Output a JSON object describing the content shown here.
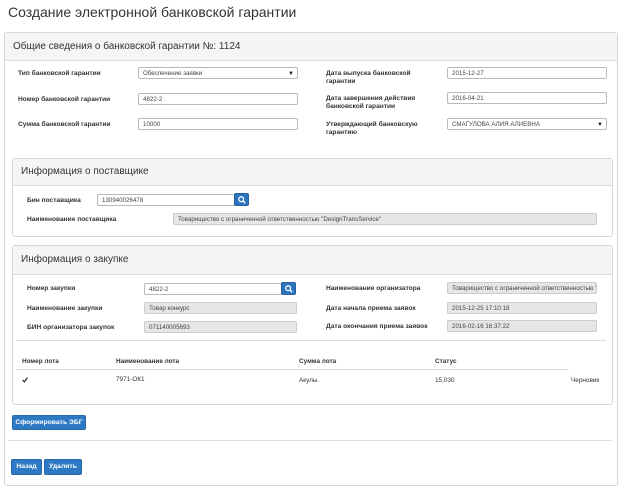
{
  "page": {
    "title": "Создание электронной банковской гарантии"
  },
  "general": {
    "header": "Общие сведения о банковской гарантии №: 1124",
    "guarantee_type": {
      "label": "Тип банковской гарантии",
      "value": "Обеспечение заявки"
    },
    "guarantee_number": {
      "label": "Номер банковской гарантии",
      "value": "4822-2"
    },
    "guarantee_amount": {
      "label": "Сумма банковской гарантии",
      "value": "10000"
    },
    "issue_date": {
      "label": "Дата выпуска банковской гарантии",
      "value": "2015-12-27"
    },
    "end_date": {
      "label": "Дата завершения действия банковской гарантии",
      "value": "2016-04-21"
    },
    "approver": {
      "label": "Утверждающий банковскую гарантию",
      "value": "СМАГУЛОВА АЛИЯ АЛИЕВНА"
    }
  },
  "supplier": {
    "header": "Информация о поставщике",
    "bin": {
      "label": "Бин поставщика",
      "value": "130940026478"
    },
    "name": {
      "label": "Наименование поставщика",
      "value": "Товарищество с ограниченной ответственностью \"DesignTransService\""
    }
  },
  "purchase": {
    "header": "Информация о закупке",
    "number": {
      "label": "Номер закупки",
      "value": "4822-2"
    },
    "name": {
      "label": "Наименование закупки",
      "value": "Товар конкурс"
    },
    "organizer_bin": {
      "label": "БИН организатора закупок",
      "value": "071140005693"
    },
    "organizer_name": {
      "label": "Наименование организатора",
      "value": "Товарищество с ограниченной ответственностью \"Це"
    },
    "start_date": {
      "label": "Дата начала приема заявок",
      "value": "2015-12-25 17:10:18"
    },
    "end_date": {
      "label": "Дата окончания приема заявок",
      "value": "2016-02-16 16:37:22"
    }
  },
  "lots": {
    "columns": [
      "Номер лота",
      "Наименование лота",
      "Сумма лота",
      "Статус"
    ],
    "rows": [
      {
        "number": "7971-ОК1",
        "amount_text": "Акулы.",
        "amount": "15,030",
        "status": "Черновик"
      }
    ]
  },
  "actions": {
    "generate": "Сформировать ЭБГ",
    "back": "Назад",
    "delete": "Удалить"
  },
  "icons": {
    "search": "search-icon",
    "dropdown": "caret-down-icon",
    "checkbox": "check-icon"
  },
  "colors": {
    "primary": "#2e79c4",
    "panel_header": "#f5f5f5",
    "readonly": "#e6e6e6"
  }
}
